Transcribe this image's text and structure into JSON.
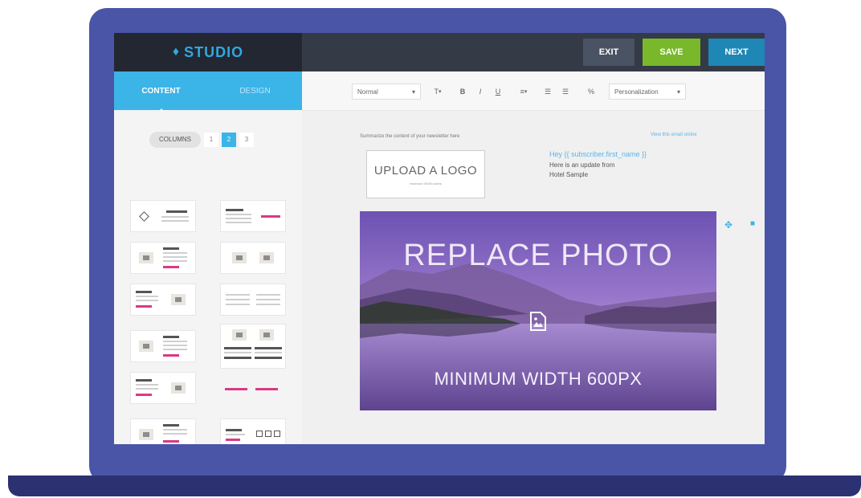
{
  "app": {
    "logo_text": "STUDIO",
    "logo_icon": "droplet-icon"
  },
  "header_buttons": {
    "exit": "EXIT",
    "save": "SAVE",
    "next": "NEXT"
  },
  "sidebar": {
    "tabs": [
      "CONTENT",
      "DESIGN"
    ],
    "active_tab": "CONTENT",
    "columns_label": "COLUMNS",
    "columns_options": [
      "1",
      "2",
      "3"
    ],
    "columns_selected": "2"
  },
  "toolbar": {
    "paragraph_format": "Normal",
    "font_size_label": "T",
    "bold": "B",
    "italic": "I",
    "underline": "U",
    "align_label": "≡",
    "list_numbered": "☰",
    "list_bullets": "☰",
    "link": "%",
    "personalization": "Personalization"
  },
  "email": {
    "preheader": "Summarize the content of your newsletter here",
    "view_online": "View this email online",
    "upload_logo_title": "UPLOAD A LOGO",
    "upload_logo_sub": "minimum 90x90 pixels",
    "greeting": "Hey {{ subscriber.first_name }}",
    "intro_line1": "Here is an update from",
    "intro_line2": "Hotel Sample",
    "photo_title": "REPLACE PHOTO",
    "photo_caption": "MINIMUM WIDTH 600PX"
  },
  "colors": {
    "accent": "#3bb4e8",
    "save_green": "#78b82a",
    "next_blue": "#1e87b6",
    "header_dark": "#343a46",
    "laptop_frame": "#4a55a8",
    "photo_purple": "#8b6cc0"
  }
}
